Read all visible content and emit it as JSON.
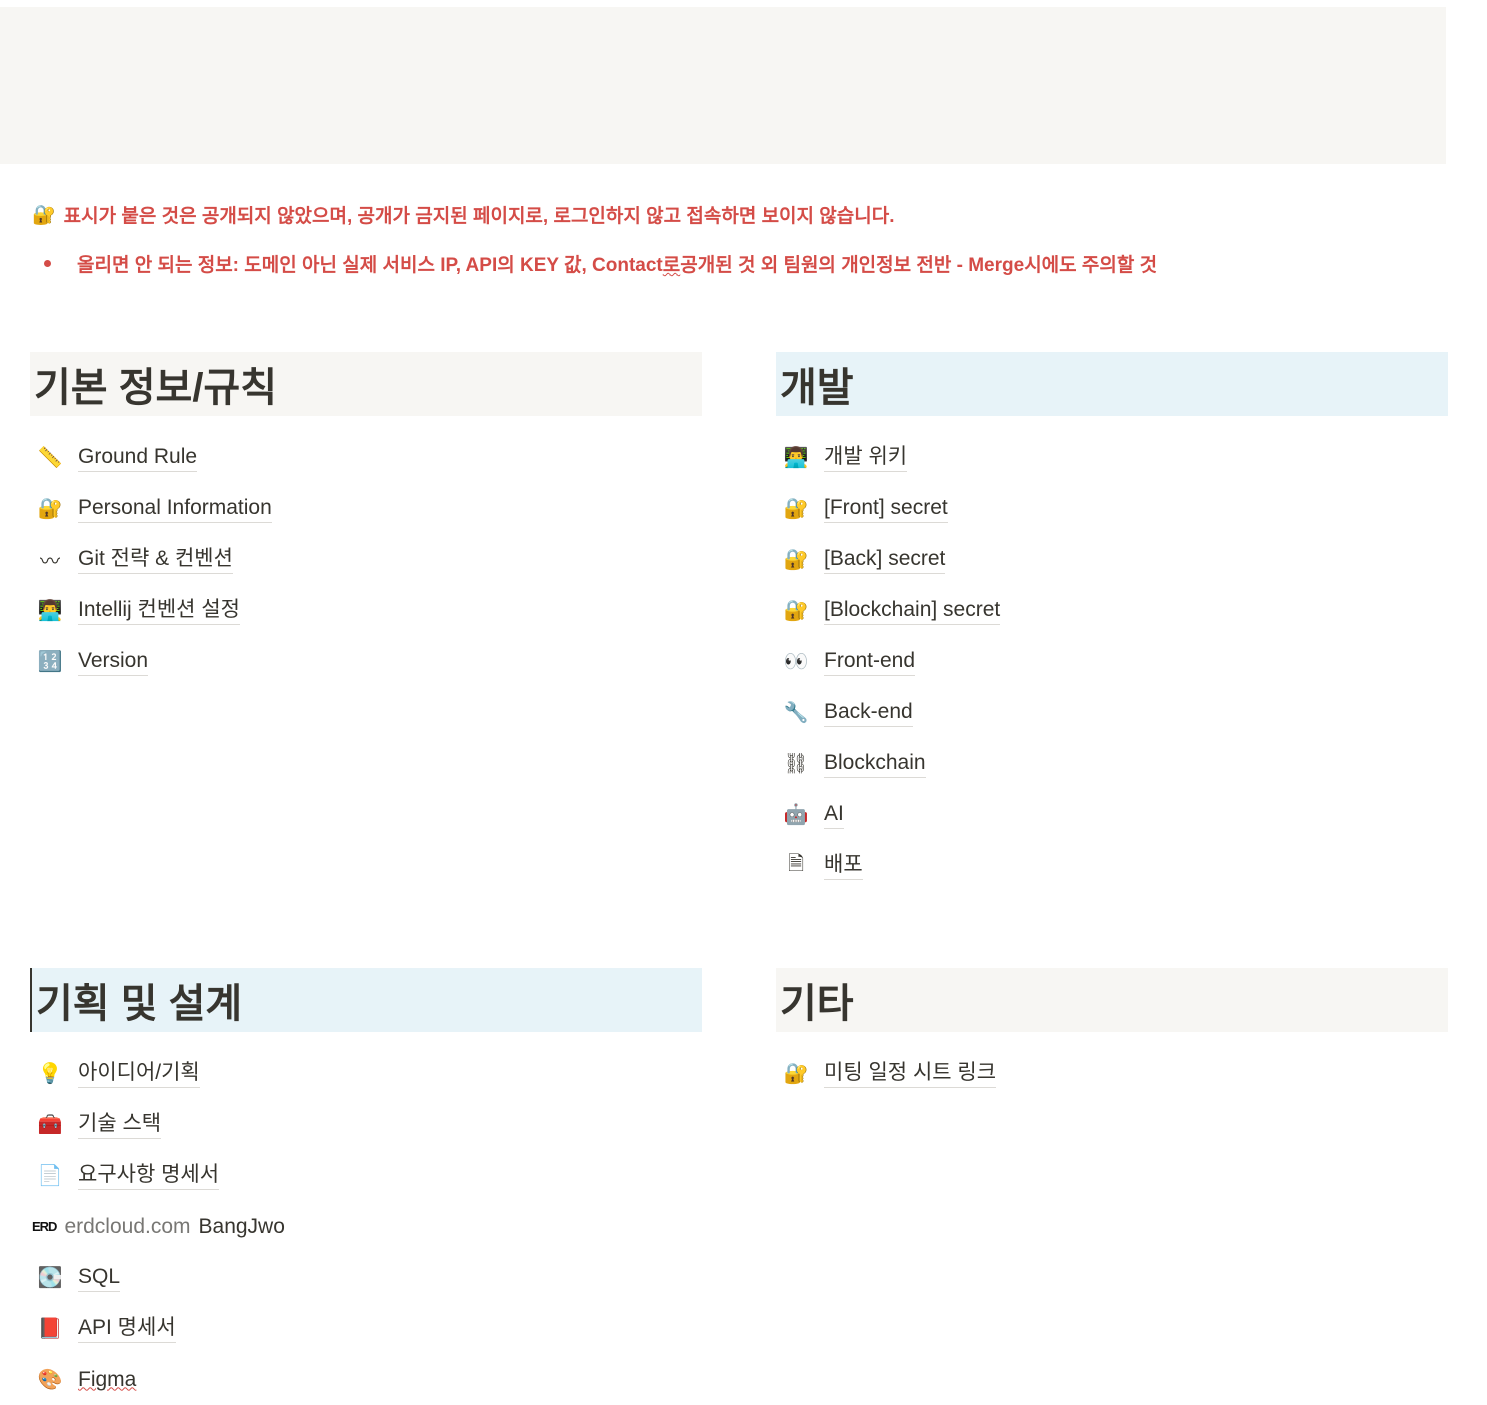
{
  "notice": {
    "icon": "🔐",
    "text": "표시가 붙은 것은 공개되지 않았으며, 공개가 금지된 페이지로, 로그인하지 않고 접속하면 보이지 않습니다.",
    "warning_a": "올리면 안 되는 정보: 도메인 아닌 실제 서비스 IP, API의 KEY 값, Contact",
    "warning_b": "로",
    "warning_c": " 공개된 것 외 팀원의 개인정보 전반 - Merge시에도 주의할 것"
  },
  "sections": {
    "basic": {
      "title": "기본 정보/규칙",
      "items": [
        {
          "icon": "📏",
          "icon_name": "ruler-icon",
          "label": "Ground Rule"
        },
        {
          "icon": "🔐",
          "icon_name": "lock-key-icon",
          "label": "Personal Information"
        },
        {
          "icon": "〰",
          "icon_name": "wavy-dash-icon",
          "label": "Git 전략 & 컨벤션"
        },
        {
          "icon": "👨‍💻",
          "icon_name": "technologist-icon",
          "label": "Intellij 컨벤션 설정"
        },
        {
          "icon": "🔢",
          "icon_name": "numbers-icon",
          "label": "Version"
        }
      ]
    },
    "dev": {
      "title": "개발",
      "items": [
        {
          "icon": "👨‍💻",
          "icon_name": "technologist-icon",
          "label": "개발 위키"
        },
        {
          "icon": "🔐",
          "icon_name": "lock-key-icon",
          "label": "[Front] secret"
        },
        {
          "icon": "🔐",
          "icon_name": "lock-key-icon",
          "label": "[Back] secret"
        },
        {
          "icon": "🔐",
          "icon_name": "lock-key-icon",
          "label": "[Blockchain] secret"
        },
        {
          "icon": "👀",
          "icon_name": "eyes-icon",
          "label": "Front-end"
        },
        {
          "icon": "🔧",
          "icon_name": "wrench-icon",
          "label": "Back-end"
        },
        {
          "icon": "⛓",
          "icon_name": "chain-icon",
          "label": "Blockchain"
        },
        {
          "icon": "🤖",
          "icon_name": "robot-icon",
          "label": "AI"
        },
        {
          "icon": "🗎",
          "icon_name": "page-icon",
          "label": "배포"
        }
      ]
    },
    "plan": {
      "title": "기획 및 설계",
      "items": [
        {
          "icon": "💡",
          "icon_name": "lightbulb-icon",
          "label": "아이디어/기획"
        },
        {
          "icon": "🧰",
          "icon_name": "toolbox-icon",
          "label": "기술 스택"
        },
        {
          "icon": "📄",
          "icon_name": "document-icon",
          "label": "요구사항 명세서"
        },
        {
          "icon": "💽",
          "icon_name": "disc-icon",
          "label": "SQL"
        },
        {
          "icon": "📕",
          "icon_name": "book-icon",
          "label": "API 명세서"
        }
      ],
      "erd": {
        "badge": "ERD",
        "site": "erdcloud.com",
        "user": "BangJwo"
      },
      "figma": {
        "icon": "🎨",
        "label": "Figma"
      }
    },
    "etc": {
      "title": "기타",
      "items": [
        {
          "icon": "🔐",
          "icon_name": "lock-key-icon",
          "label": "미팅 일정 시트 링크"
        }
      ]
    }
  }
}
